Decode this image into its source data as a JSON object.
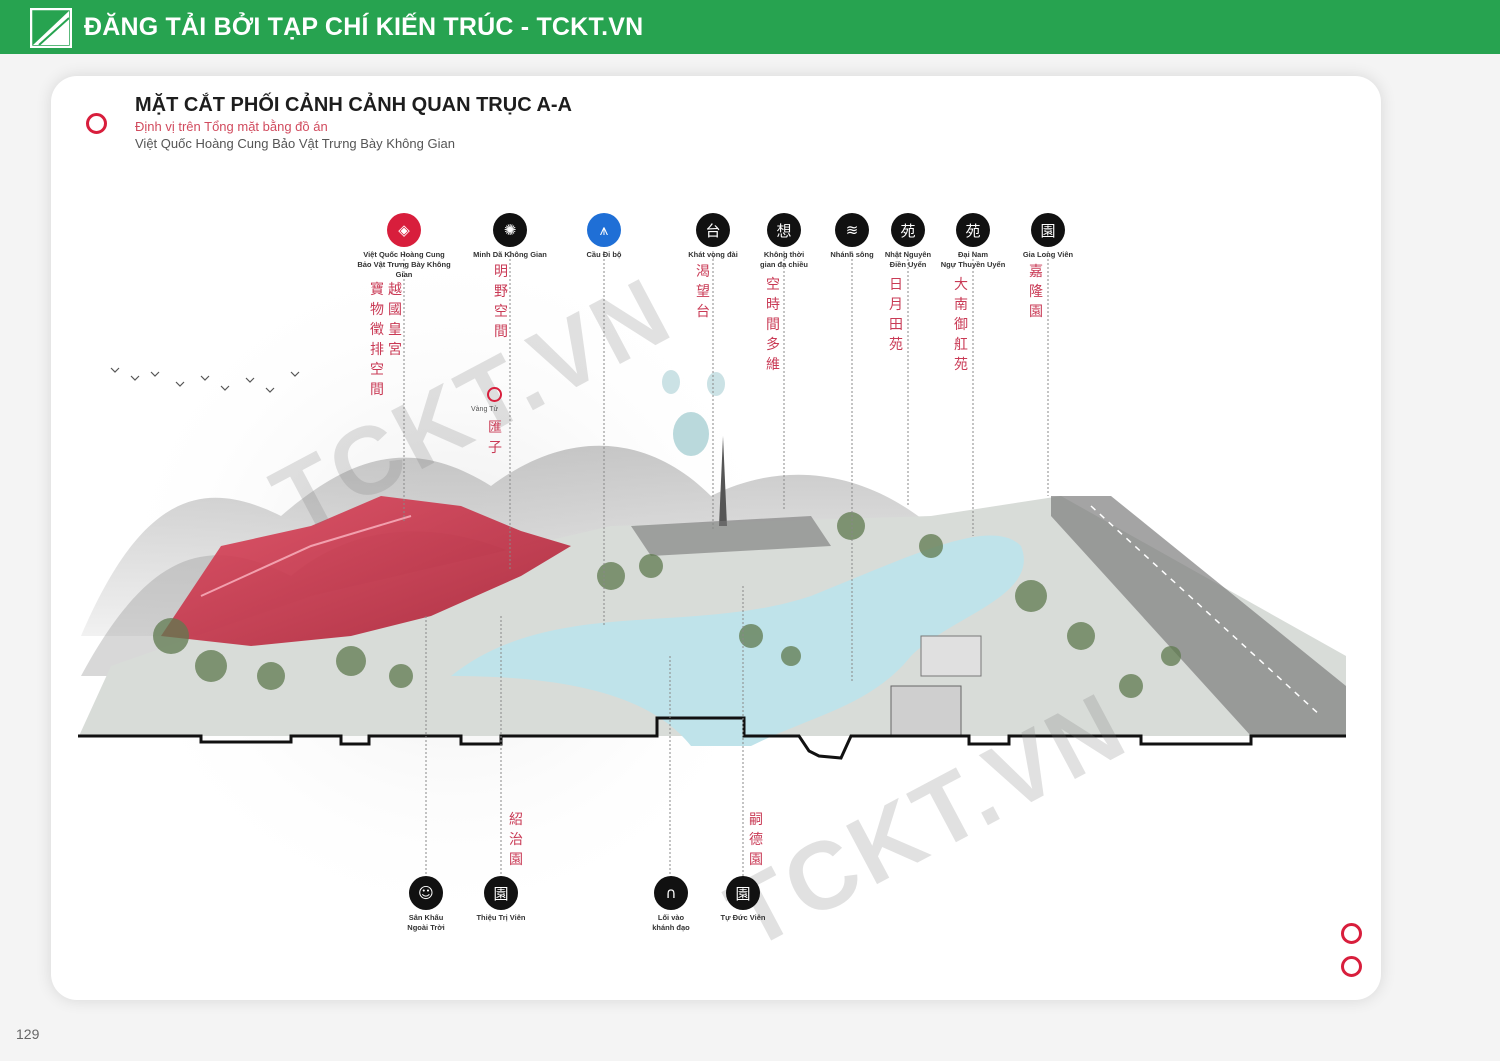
{
  "banner": {
    "text": "ĐĂNG TẢI BỞI TẠP CHÍ KIẾN TRÚC - TCKT.VN"
  },
  "header": {
    "title": "MẶT CẮT PHỐI CẢNH CẢNH QUAN TRỤC A-A",
    "subtitle_1": "Định vị trên Tổng mặt bằng đồ án",
    "subtitle_2": "Việt Quốc Hoàng Cung Bảo Vật Trưng Bày Không Gian"
  },
  "top_markers": [
    {
      "label": "Việt Quốc Hoàng Cung\nBảo Vật Trưng Bày Không Gian",
      "glyph": "◈",
      "style": "red"
    },
    {
      "label": "Minh Dã Không Gian",
      "glyph": "✺",
      "style": "dark"
    },
    {
      "label": "Cầu Đi bộ",
      "glyph": "⩚",
      "style": "blue"
    },
    {
      "label": "Khát vọng đài",
      "glyph": "台",
      "style": "dark"
    },
    {
      "label": "Không thời\ngian đa chiều",
      "glyph": "想",
      "style": "dark"
    },
    {
      "label": "Nhánh sông",
      "glyph": "≋",
      "style": "dark"
    },
    {
      "label": "Nhật Nguyên\nĐiền Uyển",
      "glyph": "苑",
      "style": "dark"
    },
    {
      "label": "Đại Nam\nNgự Thuyền Uyển",
      "glyph": "苑",
      "style": "dark"
    },
    {
      "label": "Gia Long Viên",
      "glyph": "園",
      "style": "dark"
    }
  ],
  "bottom_markers": [
    {
      "label": "Sân Khấu\nNgoài Trời",
      "glyph": "☺"
    },
    {
      "label": "Thiệu Trị Viên",
      "glyph": "園"
    },
    {
      "label": "Lối vào\nkhánh đạo",
      "glyph": "∩"
    },
    {
      "label": "Tự Đức Viên",
      "glyph": "園"
    }
  ],
  "vertical_texts": {
    "v1": "越國皇宮",
    "v2": "寶物徵排空間",
    "v3": "明野空間",
    "v4": "渴望台",
    "v5": "空時間多維",
    "v6": "日月田苑",
    "v7": "大南御舡苑",
    "v8": "嘉隆園",
    "v9": "匯子",
    "v10": "紹治園",
    "v11": "嗣德園"
  },
  "vang_tu_label": "Vàng Tử",
  "watermark": "TCKT.VN",
  "page_number": "129",
  "colors": {
    "banner_green": "#27a350",
    "accent_red": "#d81e3c",
    "cjk_red": "#c93a55",
    "water": "#bfe3ea"
  }
}
